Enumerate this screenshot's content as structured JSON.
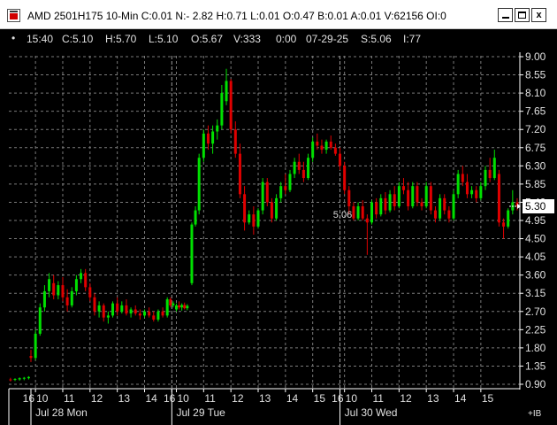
{
  "window": {
    "title": "AMD 2501H175 10-Min C:0.01 N:- 2.82 H:0.71 L:0.01 O:0.47 B:0.01 A:0.01 V:62156 OI:0",
    "minimize_icon": "minimize-icon",
    "maximize_icon": "maximize-icon",
    "close_icon": "close-icon",
    "close_glyph": "x"
  },
  "info_bar": {
    "bullet": "•",
    "time": "15:40",
    "close": "C:5.10",
    "high": "H:5.70",
    "low": "L:5.10",
    "open": "O:5.67",
    "volume": "V:333",
    "extra": "0:00",
    "date": "07-29-25",
    "settle": "S:5.06",
    "index": "I:77"
  },
  "colors": {
    "up": "#00e000",
    "down": "#e00000",
    "grid": "#7a7a7a",
    "axis": "#ffffff",
    "label_box": "#ffffff"
  },
  "ib_label": "+IB",
  "current_price_label": "5.30",
  "chart_data": {
    "type": "candlestick",
    "ylim": [
      0.9,
      9.0
    ],
    "y_ticks": [
      "9.00",
      "8.55",
      "8.10",
      "7.65",
      "7.20",
      "6.75",
      "6.30",
      "5.85",
      "5.40",
      "4.95",
      "4.50",
      "4.05",
      "3.60",
      "3.15",
      "2.70",
      "2.25",
      "1.80",
      "1.35",
      "0.90"
    ],
    "x_ticks": [
      {
        "label": "16",
        "t": 0
      },
      {
        "label": "10",
        "t": 1
      },
      {
        "label": "11",
        "t": 7
      },
      {
        "label": "12",
        "t": 13
      },
      {
        "label": "13",
        "t": 19
      },
      {
        "label": "14",
        "t": 25
      },
      {
        "label": "16",
        "t": 31
      },
      {
        "label": "10",
        "t": 32
      },
      {
        "label": "11",
        "t": 38
      },
      {
        "label": "12",
        "t": 44
      },
      {
        "label": "13",
        "t": 50
      },
      {
        "label": "14",
        "t": 56
      },
      {
        "label": "15",
        "t": 62
      },
      {
        "label": "16",
        "t": 68
      },
      {
        "label": "10",
        "t": 69
      },
      {
        "label": "11",
        "t": 75
      },
      {
        "label": "12",
        "t": 81
      },
      {
        "label": "13",
        "t": 87
      },
      {
        "label": "14",
        "t": 93
      },
      {
        "label": "15",
        "t": 99
      }
    ],
    "days": [
      {
        "label": "Jul 28 Mon",
        "t": 1
      },
      {
        "label": "Jul 29 Tue",
        "t": 32
      },
      {
        "label": "Jul 30 Wed",
        "t": 69
      }
    ],
    "day_separators": [
      0,
      31,
      68
    ],
    "session_lines": [
      31,
      68
    ],
    "last_price": 5.3,
    "annotation": {
      "label": "5.06",
      "t": 70,
      "price": 5.06
    },
    "candles": [
      {
        "t": -4.5,
        "o": 1.02,
        "h": 1.06,
        "l": 0.97,
        "c": 1.0
      },
      {
        "t": -3.5,
        "o": 1.01,
        "h": 1.05,
        "l": 0.98,
        "c": 1.03
      },
      {
        "t": -2.5,
        "o": 1.02,
        "h": 1.07,
        "l": 0.99,
        "c": 1.05
      },
      {
        "t": -1.5,
        "o": 1.04,
        "h": 1.08,
        "l": 1.0,
        "c": 1.06
      },
      {
        "t": -0.5,
        "o": 1.05,
        "h": 1.1,
        "l": 1.02,
        "c": 1.08
      },
      {
        "t": 0,
        "o": 1.6,
        "h": 1.75,
        "l": 1.45,
        "c": 1.55
      },
      {
        "t": 1,
        "o": 1.55,
        "h": 2.25,
        "l": 1.5,
        "c": 2.15
      },
      {
        "t": 2,
        "o": 2.15,
        "h": 2.9,
        "l": 2.1,
        "c": 2.8
      },
      {
        "t": 3,
        "o": 2.8,
        "h": 3.35,
        "l": 2.7,
        "c": 3.2
      },
      {
        "t": 4,
        "o": 3.2,
        "h": 3.65,
        "l": 3.05,
        "c": 3.5
      },
      {
        "t": 5,
        "o": 3.4,
        "h": 3.6,
        "l": 3.0,
        "c": 3.1
      },
      {
        "t": 6,
        "o": 3.1,
        "h": 3.45,
        "l": 3.0,
        "c": 3.35
      },
      {
        "t": 7,
        "o": 3.35,
        "h": 3.55,
        "l": 2.95,
        "c": 3.05
      },
      {
        "t": 8,
        "o": 3.05,
        "h": 3.25,
        "l": 2.7,
        "c": 2.85
      },
      {
        "t": 9,
        "o": 2.85,
        "h": 3.3,
        "l": 2.8,
        "c": 3.2
      },
      {
        "t": 10,
        "o": 3.2,
        "h": 3.6,
        "l": 3.1,
        "c": 3.5
      },
      {
        "t": 11,
        "o": 3.5,
        "h": 3.75,
        "l": 3.4,
        "c": 3.65
      },
      {
        "t": 12,
        "o": 3.65,
        "h": 3.75,
        "l": 3.2,
        "c": 3.3
      },
      {
        "t": 13,
        "o": 3.3,
        "h": 3.4,
        "l": 2.95,
        "c": 3.05
      },
      {
        "t": 14,
        "o": 3.05,
        "h": 3.15,
        "l": 2.6,
        "c": 2.7
      },
      {
        "t": 15,
        "o": 2.7,
        "h": 2.95,
        "l": 2.55,
        "c": 2.85
      },
      {
        "t": 16,
        "o": 2.85,
        "h": 2.9,
        "l": 2.45,
        "c": 2.55
      },
      {
        "t": 17,
        "o": 2.55,
        "h": 2.7,
        "l": 2.4,
        "c": 2.6
      },
      {
        "t": 18,
        "o": 2.6,
        "h": 2.95,
        "l": 2.55,
        "c": 2.9
      },
      {
        "t": 19,
        "o": 2.9,
        "h": 3.05,
        "l": 2.6,
        "c": 2.7
      },
      {
        "t": 20,
        "o": 2.7,
        "h": 2.95,
        "l": 2.65,
        "c": 2.85
      },
      {
        "t": 21,
        "o": 2.85,
        "h": 3.0,
        "l": 2.6,
        "c": 2.65
      },
      {
        "t": 22,
        "o": 2.65,
        "h": 2.8,
        "l": 2.55,
        "c": 2.75
      },
      {
        "t": 23,
        "o": 2.75,
        "h": 2.85,
        "l": 2.6,
        "c": 2.65
      },
      {
        "t": 24,
        "o": 2.65,
        "h": 2.75,
        "l": 2.5,
        "c": 2.6
      },
      {
        "t": 25,
        "o": 2.6,
        "h": 2.75,
        "l": 2.55,
        "c": 2.7
      },
      {
        "t": 26,
        "o": 2.7,
        "h": 2.8,
        "l": 2.55,
        "c": 2.6
      },
      {
        "t": 27,
        "o": 2.6,
        "h": 2.7,
        "l": 2.45,
        "c": 2.5
      },
      {
        "t": 28,
        "o": 2.5,
        "h": 2.75,
        "l": 2.45,
        "c": 2.7
      },
      {
        "t": 29,
        "o": 2.7,
        "h": 2.8,
        "l": 2.55,
        "c": 2.6
      },
      {
        "t": 30,
        "o": 2.6,
        "h": 3.05,
        "l": 2.55,
        "c": 3.0
      },
      {
        "t": 30.7,
        "o": 3.0,
        "h": 3.05,
        "l": 2.8,
        "c": 2.85
      },
      {
        "t": 31.3,
        "o": 2.85,
        "h": 2.95,
        "l": 2.8,
        "c": 2.9
      },
      {
        "t": 32,
        "o": 2.75,
        "h": 2.9,
        "l": 2.7,
        "c": 2.85
      },
      {
        "t": 32.6,
        "o": 2.85,
        "h": 2.95,
        "l": 2.75,
        "c": 2.8
      },
      {
        "t": 33.2,
        "o": 2.8,
        "h": 2.9,
        "l": 2.72,
        "c": 2.86
      },
      {
        "t": 33.8,
        "o": 2.86,
        "h": 2.92,
        "l": 2.75,
        "c": 2.78
      },
      {
        "t": 34.4,
        "o": 2.78,
        "h": 2.88,
        "l": 2.73,
        "c": 2.84
      },
      {
        "t": 35.4,
        "o": 3.4,
        "h": 4.9,
        "l": 3.35,
        "c": 4.85
      },
      {
        "t": 36.2,
        "o": 4.85,
        "h": 5.3,
        "l": 4.8,
        "c": 5.2
      },
      {
        "t": 37,
        "o": 5.2,
        "h": 6.6,
        "l": 5.1,
        "c": 6.5
      },
      {
        "t": 38,
        "o": 6.5,
        "h": 7.2,
        "l": 6.4,
        "c": 7.1
      },
      {
        "t": 39,
        "o": 7.1,
        "h": 7.3,
        "l": 6.7,
        "c": 6.85
      },
      {
        "t": 40,
        "o": 6.85,
        "h": 7.3,
        "l": 6.6,
        "c": 7.15
      },
      {
        "t": 41,
        "o": 7.15,
        "h": 7.45,
        "l": 6.95,
        "c": 7.3
      },
      {
        "t": 42,
        "o": 7.3,
        "h": 8.3,
        "l": 7.2,
        "c": 8.1
      },
      {
        "t": 43,
        "o": 7.9,
        "h": 8.7,
        "l": 7.8,
        "c": 8.4
      },
      {
        "t": 44,
        "o": 8.4,
        "h": 8.45,
        "l": 7.1,
        "c": 7.2
      },
      {
        "t": 45,
        "o": 7.2,
        "h": 7.4,
        "l": 6.5,
        "c": 6.6
      },
      {
        "t": 46,
        "o": 6.6,
        "h": 6.85,
        "l": 5.5,
        "c": 5.6
      },
      {
        "t": 47,
        "o": 5.6,
        "h": 5.8,
        "l": 4.7,
        "c": 4.9
      },
      {
        "t": 48,
        "o": 4.9,
        "h": 5.2,
        "l": 4.85,
        "c": 5.1
      },
      {
        "t": 49,
        "o": 5.1,
        "h": 5.3,
        "l": 4.6,
        "c": 4.8
      },
      {
        "t": 50,
        "o": 4.8,
        "h": 5.25,
        "l": 4.75,
        "c": 5.2
      },
      {
        "t": 51,
        "o": 5.2,
        "h": 6.0,
        "l": 5.1,
        "c": 5.9
      },
      {
        "t": 52,
        "o": 5.9,
        "h": 6.0,
        "l": 5.3,
        "c": 5.4
      },
      {
        "t": 53,
        "o": 5.4,
        "h": 5.5,
        "l": 4.9,
        "c": 5.0
      },
      {
        "t": 54,
        "o": 5.0,
        "h": 5.6,
        "l": 4.95,
        "c": 5.5
      },
      {
        "t": 55,
        "o": 5.5,
        "h": 5.9,
        "l": 5.4,
        "c": 5.8
      },
      {
        "t": 56,
        "o": 5.8,
        "h": 6.1,
        "l": 5.6,
        "c": 5.7
      },
      {
        "t": 57,
        "o": 5.7,
        "h": 6.2,
        "l": 5.65,
        "c": 6.1
      },
      {
        "t": 58,
        "o": 6.1,
        "h": 6.5,
        "l": 6.0,
        "c": 6.4
      },
      {
        "t": 59,
        "o": 6.4,
        "h": 6.6,
        "l": 6.1,
        "c": 6.2
      },
      {
        "t": 60,
        "o": 6.2,
        "h": 6.4,
        "l": 5.9,
        "c": 6.0
      },
      {
        "t": 61,
        "o": 6.0,
        "h": 6.6,
        "l": 5.95,
        "c": 6.5
      },
      {
        "t": 62,
        "o": 6.5,
        "h": 7.0,
        "l": 6.4,
        "c": 6.9
      },
      {
        "t": 63,
        "o": 6.9,
        "h": 7.1,
        "l": 6.7,
        "c": 6.8
      },
      {
        "t": 64,
        "o": 6.8,
        "h": 6.95,
        "l": 6.6,
        "c": 6.7
      },
      {
        "t": 65,
        "o": 6.7,
        "h": 6.95,
        "l": 6.6,
        "c": 6.9
      },
      {
        "t": 66,
        "o": 6.9,
        "h": 7.05,
        "l": 6.7,
        "c": 6.75
      },
      {
        "t": 67,
        "o": 6.75,
        "h": 6.85,
        "l": 6.55,
        "c": 6.6
      },
      {
        "t": 68,
        "o": 6.6,
        "h": 6.75,
        "l": 6.2,
        "c": 6.3
      },
      {
        "t": 69,
        "o": 6.3,
        "h": 6.4,
        "l": 5.6,
        "c": 5.7
      },
      {
        "t": 70,
        "o": 5.7,
        "h": 5.8,
        "l": 5.1,
        "c": 5.3
      },
      {
        "t": 71,
        "o": 5.3,
        "h": 5.4,
        "l": 4.95,
        "c": 5.0
      },
      {
        "t": 72,
        "o": 5.0,
        "h": 5.4,
        "l": 4.95,
        "c": 5.3
      },
      {
        "t": 73,
        "o": 5.3,
        "h": 5.45,
        "l": 4.95,
        "c": 5.0
      },
      {
        "t": 74,
        "o": 5.0,
        "h": 5.1,
        "l": 4.1,
        "c": 4.9
      },
      {
        "t": 75,
        "o": 4.9,
        "h": 5.45,
        "l": 4.85,
        "c": 5.4
      },
      {
        "t": 76,
        "o": 5.4,
        "h": 5.5,
        "l": 5.0,
        "c": 5.1
      },
      {
        "t": 77,
        "o": 5.1,
        "h": 5.6,
        "l": 5.05,
        "c": 5.5
      },
      {
        "t": 78,
        "o": 5.5,
        "h": 5.65,
        "l": 5.1,
        "c": 5.2
      },
      {
        "t": 79,
        "o": 5.2,
        "h": 5.7,
        "l": 5.15,
        "c": 5.6
      },
      {
        "t": 80,
        "o": 5.6,
        "h": 5.8,
        "l": 5.2,
        "c": 5.3
      },
      {
        "t": 81,
        "o": 5.3,
        "h": 5.9,
        "l": 5.25,
        "c": 5.8
      },
      {
        "t": 82,
        "o": 5.8,
        "h": 6.0,
        "l": 5.6,
        "c": 5.7
      },
      {
        "t": 83,
        "o": 5.7,
        "h": 5.9,
        "l": 5.2,
        "c": 5.3
      },
      {
        "t": 84,
        "o": 5.3,
        "h": 5.9,
        "l": 5.25,
        "c": 5.8
      },
      {
        "t": 85,
        "o": 5.8,
        "h": 5.9,
        "l": 5.3,
        "c": 5.4
      },
      {
        "t": 86,
        "o": 5.4,
        "h": 5.5,
        "l": 5.2,
        "c": 5.3
      },
      {
        "t": 87,
        "o": 5.3,
        "h": 5.9,
        "l": 5.25,
        "c": 5.8
      },
      {
        "t": 88,
        "o": 5.8,
        "h": 5.9,
        "l": 5.1,
        "c": 5.2
      },
      {
        "t": 89,
        "o": 5.2,
        "h": 5.3,
        "l": 4.9,
        "c": 5.0
      },
      {
        "t": 90,
        "o": 5.0,
        "h": 5.6,
        "l": 4.95,
        "c": 5.5
      },
      {
        "t": 91,
        "o": 5.5,
        "h": 5.6,
        "l": 5.1,
        "c": 5.2
      },
      {
        "t": 92,
        "o": 5.2,
        "h": 5.3,
        "l": 4.9,
        "c": 5.0
      },
      {
        "t": 93,
        "o": 5.0,
        "h": 5.7,
        "l": 4.95,
        "c": 5.6
      },
      {
        "t": 94,
        "o": 5.6,
        "h": 6.2,
        "l": 5.5,
        "c": 6.1
      },
      {
        "t": 95,
        "o": 6.1,
        "h": 6.3,
        "l": 5.8,
        "c": 5.9
      },
      {
        "t": 96,
        "o": 5.9,
        "h": 6.1,
        "l": 5.5,
        "c": 5.6
      },
      {
        "t": 97,
        "o": 5.6,
        "h": 5.8,
        "l": 5.5,
        "c": 5.7
      },
      {
        "t": 98,
        "o": 5.7,
        "h": 5.8,
        "l": 5.4,
        "c": 5.5
      },
      {
        "t": 99,
        "o": 5.5,
        "h": 5.9,
        "l": 5.45,
        "c": 5.8
      },
      {
        "t": 100,
        "o": 5.8,
        "h": 6.3,
        "l": 5.7,
        "c": 6.2
      },
      {
        "t": 101,
        "o": 6.2,
        "h": 6.5,
        "l": 5.9,
        "c": 6.0
      },
      {
        "t": 102,
        "o": 6.0,
        "h": 6.7,
        "l": 5.95,
        "c": 6.5
      },
      {
        "t": 103,
        "o": 6.1,
        "h": 6.2,
        "l": 4.8,
        "c": 4.9
      },
      {
        "t": 104,
        "o": 4.9,
        "h": 5.0,
        "l": 4.5,
        "c": 4.8
      },
      {
        "t": 105,
        "o": 4.8,
        "h": 5.25,
        "l": 4.75,
        "c": 5.2
      },
      {
        "t": 106,
        "o": 5.2,
        "h": 5.7,
        "l": 5.1,
        "c": 5.4
      },
      {
        "t": 107,
        "o": 5.4,
        "h": 5.5,
        "l": 5.2,
        "c": 5.3
      }
    ]
  }
}
